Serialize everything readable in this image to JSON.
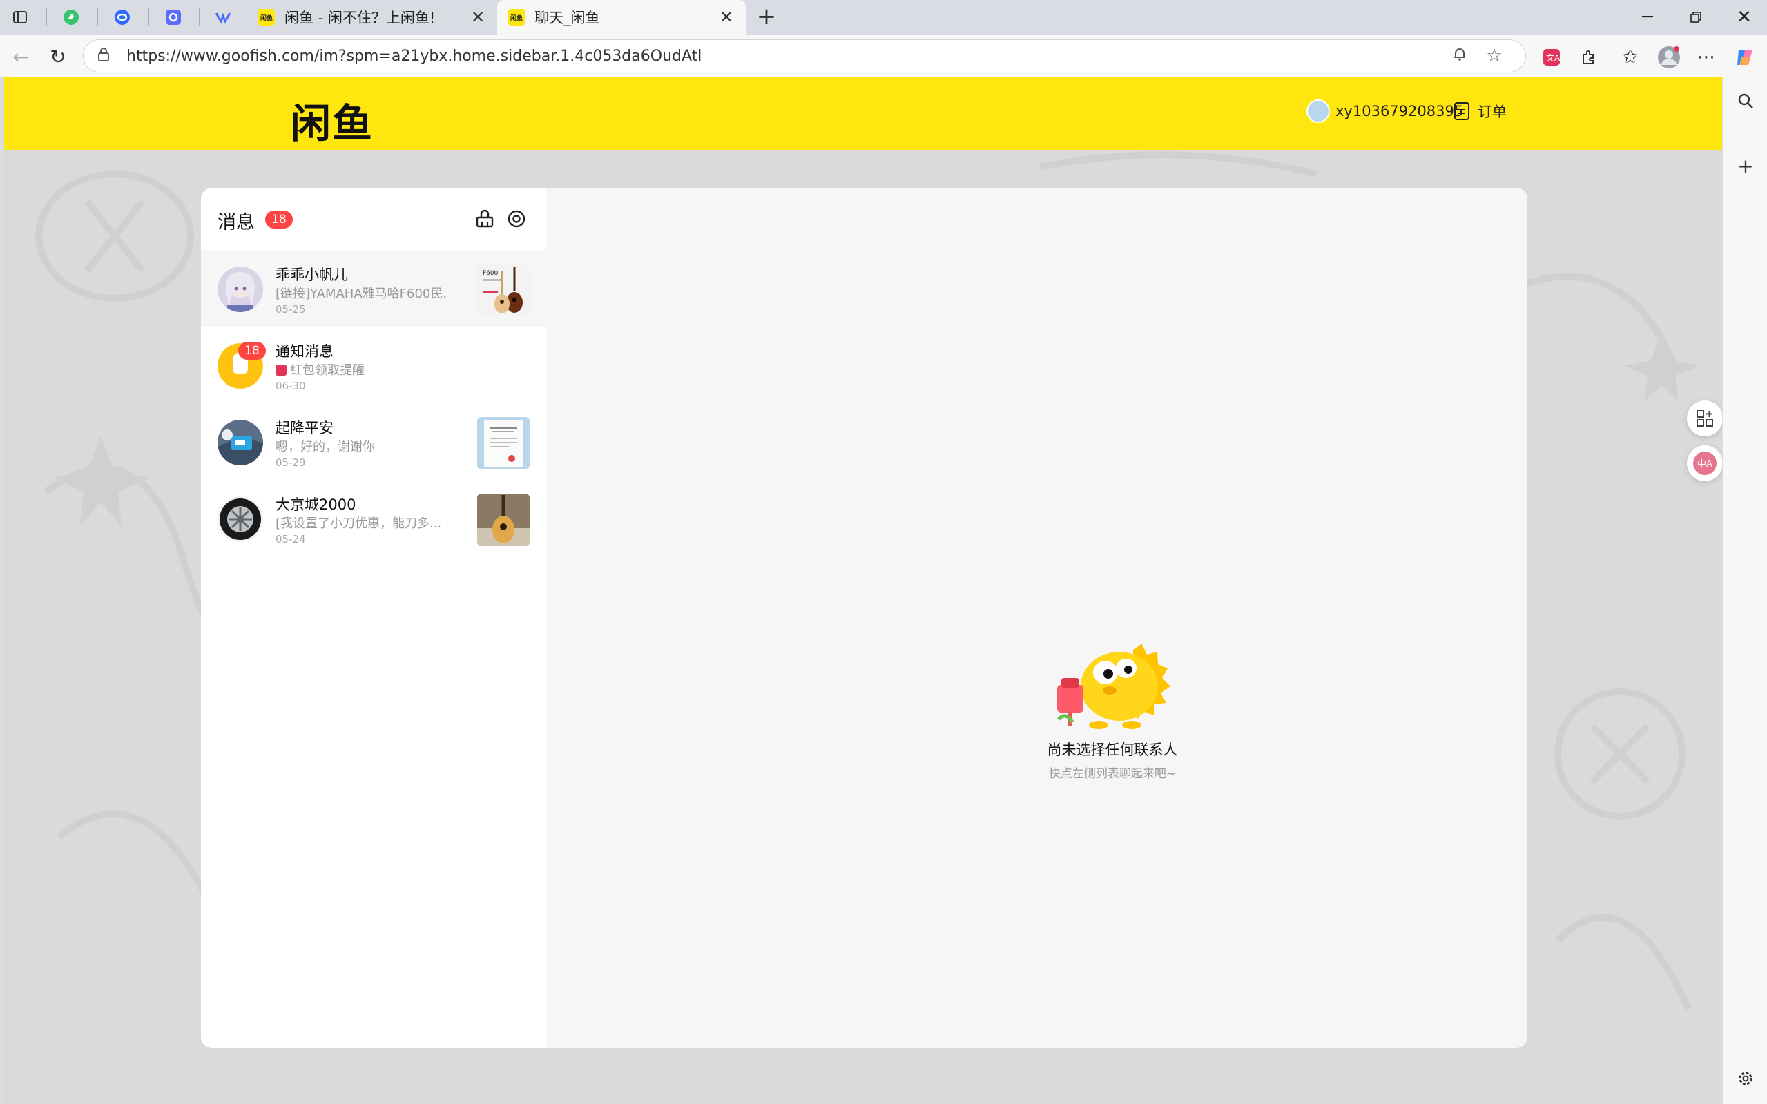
{
  "browser": {
    "tabs": [
      {
        "title": "闲鱼 - 闲不住？上闲鱼!",
        "favicon_text": "闲鱼",
        "active": false
      },
      {
        "title": "聊天_闲鱼",
        "favicon_text": "闲鱼",
        "active": true
      }
    ],
    "new_tab_label": "+",
    "url": "https://www.goofish.com/im?spm=a21ybx.home.sidebar.1.4c053da6OudAtl",
    "colors": {
      "brand_yellow": "#ffe60f",
      "badge_red": "#ff4444"
    }
  },
  "header": {
    "logo": "闲鱼",
    "username": "xy103679208395",
    "orders_label": "订单"
  },
  "messages": {
    "title": "消息",
    "unread_count": "18",
    "conversations": [
      {
        "name": "乖乖小帆儿",
        "preview": "[链接]YAMAHA雅马哈F600民...",
        "date": "05-25",
        "selected": true
      },
      {
        "name": "通知消息",
        "preview": "红包领取提醒",
        "date": "06-30",
        "badge": "18"
      },
      {
        "name": "起降平安",
        "preview": "嗯，好的，谢谢你",
        "date": "05-29"
      },
      {
        "name": "大京城2000",
        "preview": "[我设置了小刀优惠，能刀多...",
        "date": "05-24"
      }
    ],
    "thumb_text": "F600"
  },
  "empty_state": {
    "title": "尚未选择任何联系人",
    "subtitle": "快点左侧列表聊起来吧~"
  }
}
